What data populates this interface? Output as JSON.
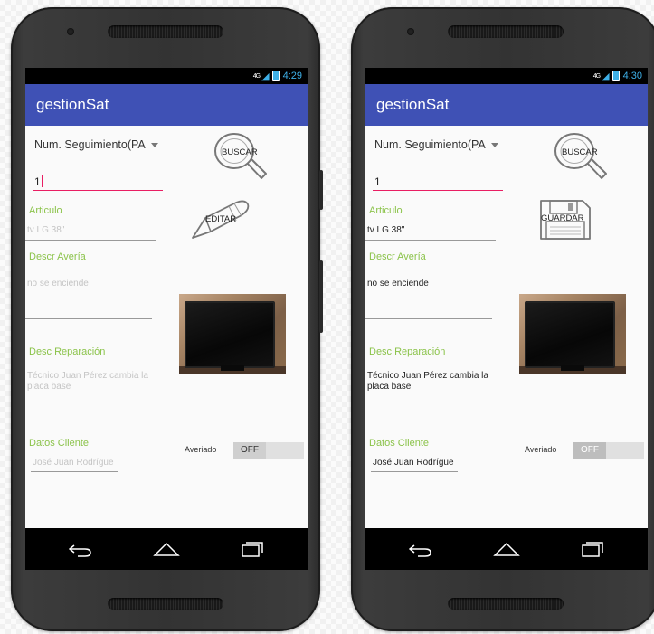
{
  "phone1": {
    "status": {
      "network": "4G",
      "time": "4:29"
    },
    "app_title": "gestionSat",
    "spinner_selected": "Num. Seguimiento(PA",
    "tracking_value": "1",
    "article": {
      "label": "Articulo",
      "value": "tv LG 38\""
    },
    "fault": {
      "label": "Descr Avería",
      "value": "no se enciende"
    },
    "repair": {
      "label": "Desc Reparación",
      "value": "Técnico Juan Pérez cambia la placa base"
    },
    "client": {
      "label": "Datos Cliente",
      "value": "José Juan Rodrígue"
    },
    "search_button": "BUSCAR",
    "action_button": "EDITAR",
    "toggle": {
      "label": "Averiado",
      "state": "OFF"
    }
  },
  "phone2": {
    "status": {
      "network": "4G",
      "time": "4:30"
    },
    "app_title": "gestionSat",
    "spinner_selected": "Num. Seguimiento(PA",
    "tracking_value": "1",
    "article": {
      "label": "Articulo",
      "value": "tv LG 38\""
    },
    "fault": {
      "label": "Descr Avería",
      "value": "no se enciende"
    },
    "repair": {
      "label": "Desc Reparación",
      "value": "Técnico Juan Pérez cambia la placa base"
    },
    "client": {
      "label": "Datos Cliente",
      "value": "José Juan Rodrígue"
    },
    "search_button": "BUSCAR",
    "action_button": "GUARDAR",
    "toggle": {
      "label": "Averiado",
      "state": "OFF"
    }
  },
  "icons": {
    "search": "magnifier-icon",
    "edit": "pencil-icon",
    "save": "floppy-disk-icon",
    "nav_back": "back-arrow-icon",
    "nav_home": "home-icon",
    "nav_recents": "recents-icon"
  },
  "colors": {
    "app_bar": "#3f51b5",
    "label_green": "#8bc34a",
    "focus_pink": "#e91e63",
    "status_blue": "#3eb0e8"
  }
}
